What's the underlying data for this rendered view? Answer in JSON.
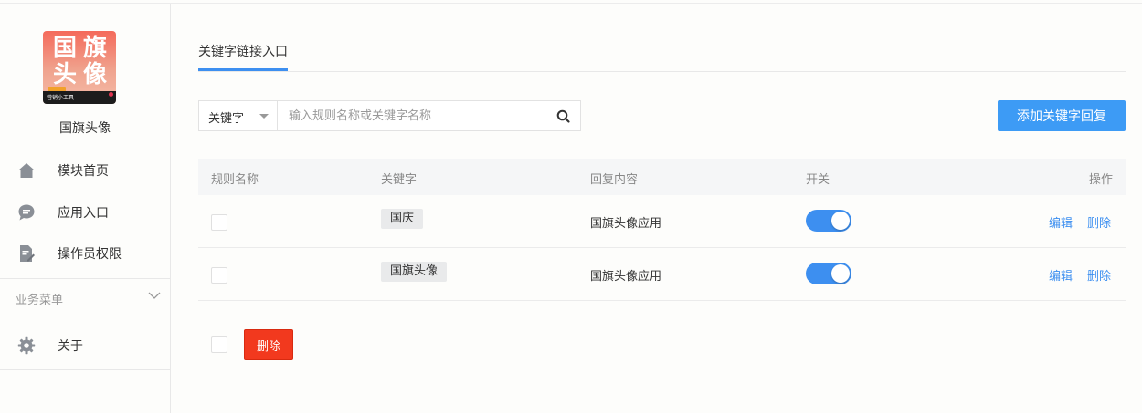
{
  "app": {
    "name": "国旗头像",
    "logo": {
      "chars": [
        "国",
        "旗",
        "头",
        "像"
      ],
      "strip_text": "营销小工具"
    }
  },
  "sidebar": {
    "items": [
      {
        "label": "模块首页",
        "icon": "home-icon"
      },
      {
        "label": "应用入口",
        "icon": "chat-bubble-icon"
      },
      {
        "label": "操作员权限",
        "icon": "document-edit-icon"
      }
    ],
    "section": {
      "title": "业务菜单",
      "icon": "chevron-down-icon"
    },
    "section_items": [
      {
        "label": "关于",
        "icon": "gear-icon"
      }
    ]
  },
  "tabs": [
    {
      "label": "关键字链接入口",
      "active": true
    }
  ],
  "search": {
    "type_value": "关键字",
    "placeholder": "输入规则名称或关键字名称"
  },
  "toolbar": {
    "add_label": "添加关键字回复",
    "delete_label": "删除"
  },
  "table": {
    "columns": [
      "规则名称",
      "关键字",
      "回复内容",
      "开关",
      "操作"
    ],
    "rows": [
      {
        "rule_name": "",
        "keyword": "国庆",
        "reply": "国旗头像应用",
        "enabled": true,
        "edit": "编辑",
        "delete": "删除"
      },
      {
        "rule_name": "",
        "keyword": "国旗头像",
        "reply": "国旗头像应用",
        "enabled": true,
        "edit": "编辑",
        "delete": "删除"
      }
    ]
  },
  "colors": {
    "accent": "#3d8ff0",
    "primary_button": "#3d9bf5",
    "danger_button": "#f2391e"
  }
}
